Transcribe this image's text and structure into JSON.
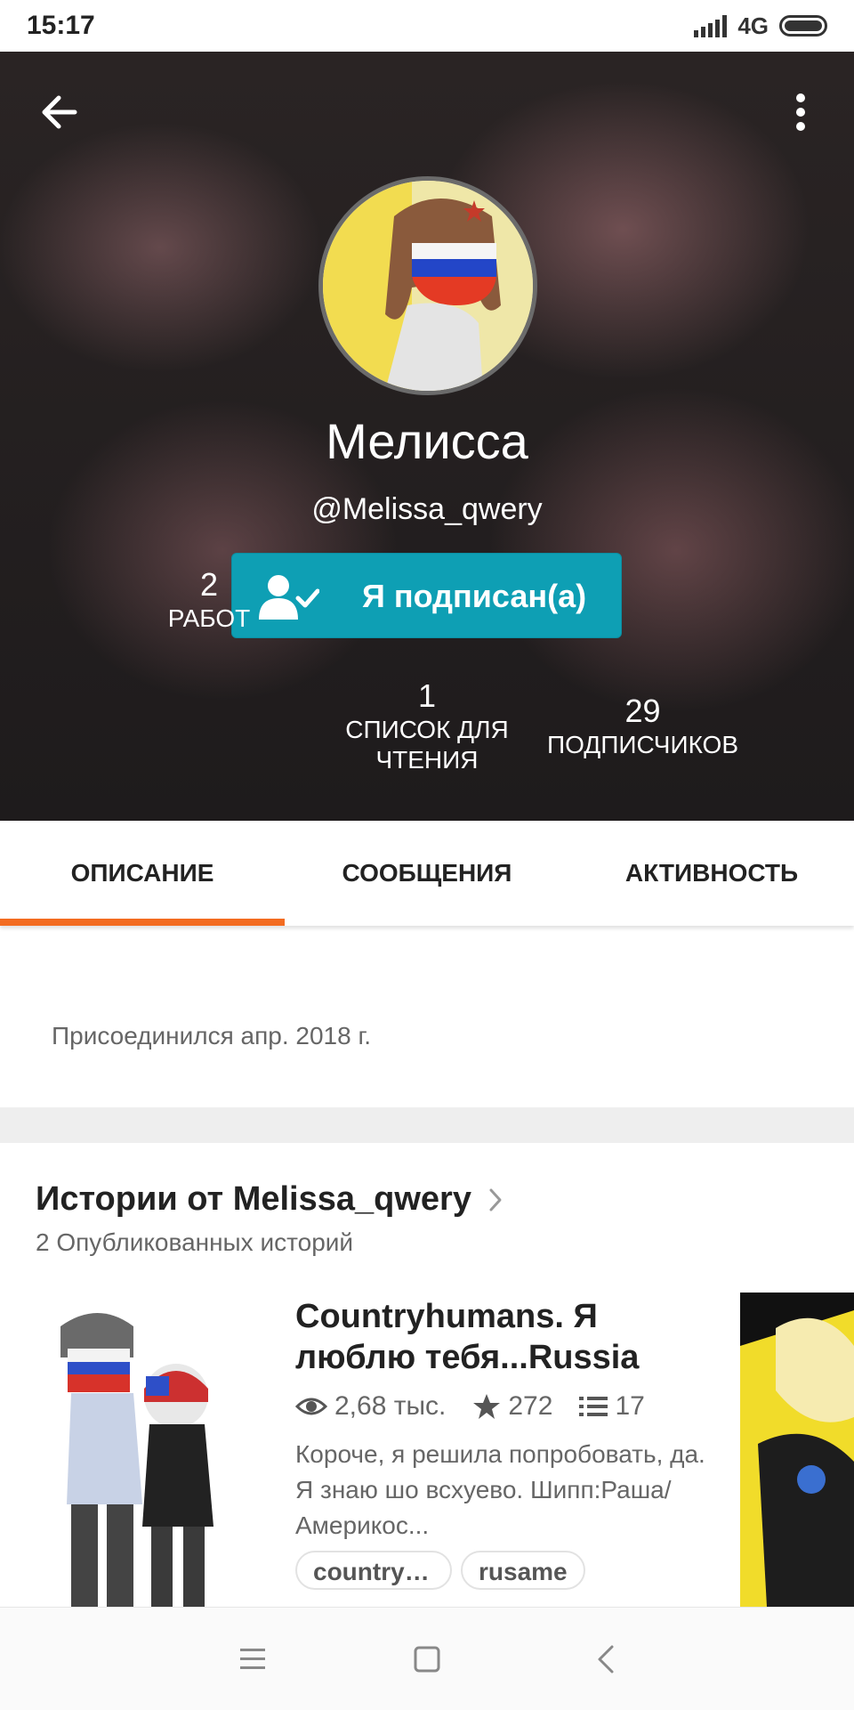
{
  "status_bar": {
    "time": "15:17",
    "network": "4G"
  },
  "profile": {
    "name": "Мелисса",
    "handle": "@Melissa_qwery",
    "follow_label": "Я подписан(а)",
    "stats": [
      {
        "value": "2",
        "label": "РАБОТ"
      },
      {
        "value": "1",
        "label": "СПИСОК ДЛЯ ЧТЕНИЯ"
      },
      {
        "value": "29",
        "label": "ПОДПИСЧИКОВ"
      }
    ]
  },
  "tabs": [
    {
      "label": "ОПИСАНИЕ",
      "active": true
    },
    {
      "label": "СООБЩЕНИЯ",
      "active": false
    },
    {
      "label": "АКТИВНОСТЬ",
      "active": false
    }
  ],
  "about": {
    "joined": "Присоединился апр. 2018 г."
  },
  "stories": {
    "title": "Истории от Melissa_qwery",
    "subtitle": "2 Опубликованных историй",
    "items": [
      {
        "title": "Countryhumans. Я люблю тебя...Russia",
        "views": "2,68 тыс.",
        "votes": "272",
        "parts": "17",
        "description": "Короче, я решила попробовать, да. Я знаю шо всхуево. Шипп:Раша/Америкос...",
        "tags": [
          "countryhu…",
          "rusame"
        ]
      }
    ]
  },
  "colors": {
    "accent": "#f36c21",
    "follow_button": "#0e9fb4"
  }
}
